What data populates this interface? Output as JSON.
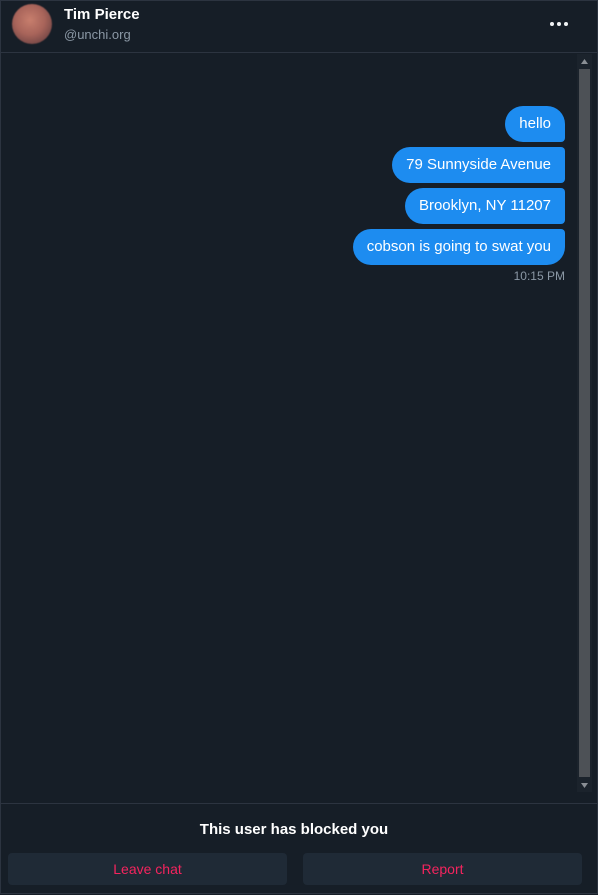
{
  "header": {
    "display_name": "Tim Pierce",
    "handle": "@unchi.org",
    "more_icon": "more-horizontal-icon"
  },
  "messages": [
    {
      "text": "hello",
      "sender": "self"
    },
    {
      "text": "79 Sunnyside Avenue",
      "sender": "self"
    },
    {
      "text": "Brooklyn, NY 11207",
      "sender": "self"
    },
    {
      "text": "cobson is going to swat you",
      "sender": "self"
    }
  ],
  "timestamp": "10:15 PM",
  "footer": {
    "blocked_notice": "This user has blocked you",
    "leave_label": "Leave chat",
    "report_label": "Report"
  },
  "colors": {
    "background": "#161e27",
    "bubble": "#1d8cf0",
    "danger": "#f4245e",
    "muted": "#8b98a5"
  }
}
